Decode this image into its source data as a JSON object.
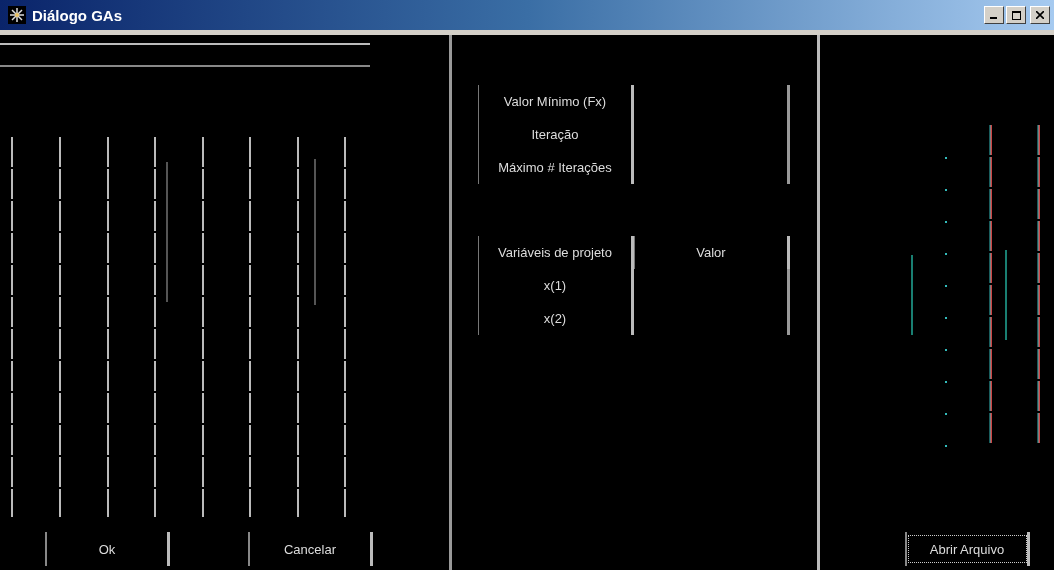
{
  "window": {
    "title": "Diálogo GAs"
  },
  "results": {
    "rows": [
      {
        "label": "Valor Mínimo (Fx)"
      },
      {
        "label": "Iteração"
      },
      {
        "label": "Máximo # Iterações"
      }
    ]
  },
  "variables": {
    "columns": [
      "Variáveis de projeto",
      "Valor"
    ],
    "rows": [
      {
        "label": "x(1)"
      },
      {
        "label": "x(2)"
      }
    ]
  },
  "buttons": {
    "left": [
      "Ok",
      "Cancelar"
    ],
    "right": [
      "Abrir Arquivo"
    ]
  }
}
